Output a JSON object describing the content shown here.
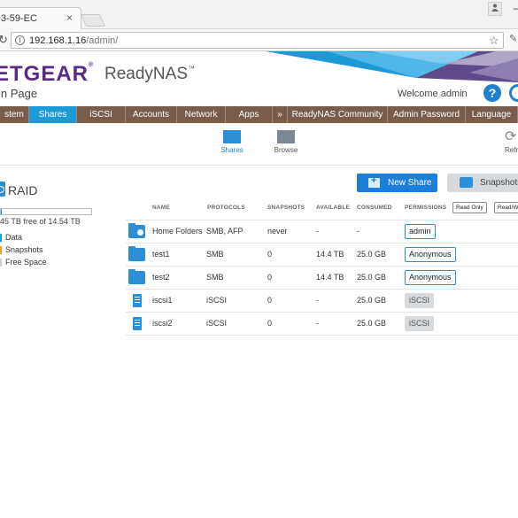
{
  "browser": {
    "tab_title": "3-59-EC",
    "tab_close": "×",
    "url_host": "192.168.1.16",
    "url_path": "/admin/",
    "minimize_glyph": "–"
  },
  "header": {
    "logo_text": "ETGEAR",
    "logo_mark": "®",
    "product": "ReadyNAS",
    "product_mark": "™",
    "page_name": "in Page",
    "welcome": "Welcome admin",
    "help_glyph": "?"
  },
  "nav": [
    {
      "label": "stem",
      "active": false
    },
    {
      "label": "Shares",
      "active": true
    },
    {
      "label": "iSCSI",
      "active": false
    },
    {
      "label": "Accounts",
      "active": false
    },
    {
      "label": "Network",
      "active": false
    },
    {
      "label": "Apps",
      "active": false
    },
    {
      "label": "»",
      "active": false
    },
    {
      "label": "ReadyNAS Community",
      "active": false
    },
    {
      "label": "Admin Password",
      "active": false
    },
    {
      "label": "Language",
      "active": false
    }
  ],
  "subtoolbar": {
    "shares": "Shares",
    "browse": "Browse",
    "refresh": "Refr"
  },
  "raid": {
    "title": "RAID",
    "free_text": "45 TB free of 14.54 TB",
    "used_fraction": 0.01,
    "legend": [
      {
        "label": "Data",
        "color": "#1b9ad6"
      },
      {
        "label": "Snapshots",
        "color": "#f0a030"
      },
      {
        "label": "Free Space",
        "color": "#cccccc"
      }
    ]
  },
  "actions": {
    "new_share": "New Share",
    "snapshots": "Snapshots"
  },
  "table": {
    "headers": {
      "name": "NAME",
      "protocols": "PROTOCOLS",
      "snapshots": "SNAPSHOTS",
      "available": "AVAILABLE",
      "consumed": "CONSUMED",
      "permissions": "PERMISSIONS"
    },
    "perm_filters": [
      "Read Only",
      "Read/W"
    ],
    "rows": [
      {
        "icon": "home-folder-icon",
        "name": "Home Folders",
        "protocols": "SMB, AFP",
        "snapshots": "never",
        "available": "-",
        "consumed": "-",
        "permission": "admin",
        "perm_style": "outlined"
      },
      {
        "icon": "folder-icon",
        "name": "test1",
        "protocols": "SMB",
        "snapshots": "0",
        "available": "14.4 TB",
        "consumed": "25.0 GB",
        "permission": "Anonymous",
        "perm_style": "outlined"
      },
      {
        "icon": "folder-icon",
        "name": "test2",
        "protocols": "SMB",
        "snapshots": "0",
        "available": "14.4 TB",
        "consumed": "25.0 GB",
        "permission": "Anonymous",
        "perm_style": "outlined"
      },
      {
        "icon": "lun-icon",
        "name": "iscsi1",
        "protocols": "iSCSI",
        "snapshots": "0",
        "available": "-",
        "consumed": "25.0 GB",
        "permission": "iSCSI",
        "perm_style": "gray"
      },
      {
        "icon": "lun-icon",
        "name": "iscsi2",
        "protocols": "iSCSI",
        "snapshots": "0",
        "available": "-",
        "consumed": "25.0 GB",
        "permission": "iSCSI",
        "perm_style": "gray"
      }
    ]
  }
}
